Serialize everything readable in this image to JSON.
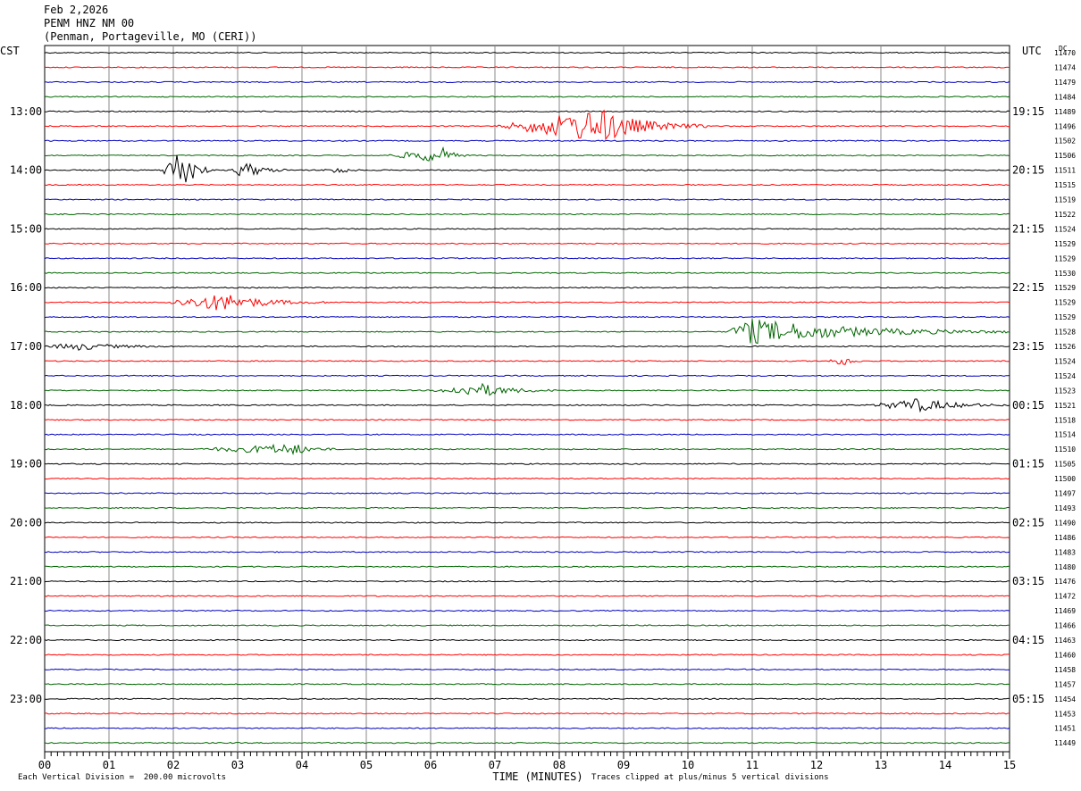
{
  "header": {
    "date": "Feb 2,2026",
    "station": "PENM HNZ NM 00",
    "location": "(Penman, Portageville, MO (CERI))"
  },
  "axis_labels": {
    "left_zone": "CST",
    "right_zone": "UTC",
    "dc": "DC",
    "x_title": "TIME (MINUTES)"
  },
  "footer": {
    "scale": "Each Vertical Division =  200.00 microvolts",
    "clip": "Traces clipped at plus/minus 5 vertical divisions"
  },
  "chart_data": {
    "type": "line",
    "title": "PENM HNZ NM 00",
    "xlabel": "TIME (MINUTES)",
    "xlim": [
      0,
      15
    ],
    "x_ticks": [
      "00",
      "01",
      "02",
      "03",
      "04",
      "05",
      "06",
      "07",
      "08",
      "09",
      "10",
      "11",
      "12",
      "13",
      "14",
      "15"
    ],
    "trace_colors": [
      "#000000",
      "#ff0000",
      "#0000c0",
      "#006600"
    ],
    "left_time_labels": [
      {
        "row": 4,
        "label": "13:00"
      },
      {
        "row": 8,
        "label": "14:00"
      },
      {
        "row": 12,
        "label": "15:00"
      },
      {
        "row": 16,
        "label": "16:00"
      },
      {
        "row": 20,
        "label": "17:00"
      },
      {
        "row": 24,
        "label": "18:00"
      },
      {
        "row": 28,
        "label": "19:00"
      },
      {
        "row": 32,
        "label": "20:00"
      },
      {
        "row": 36,
        "label": "21:00"
      },
      {
        "row": 40,
        "label": "22:00"
      },
      {
        "row": 44,
        "label": "23:00"
      }
    ],
    "right_time_labels": [
      {
        "row": 4,
        "label": "19:15"
      },
      {
        "row": 8,
        "label": "20:15"
      },
      {
        "row": 12,
        "label": "21:15"
      },
      {
        "row": 16,
        "label": "22:15"
      },
      {
        "row": 20,
        "label": "23:15"
      },
      {
        "row": 24,
        "label": "00:15"
      },
      {
        "row": 28,
        "label": "01:15"
      },
      {
        "row": 32,
        "label": "02:15"
      },
      {
        "row": 36,
        "label": "03:15"
      },
      {
        "row": 40,
        "label": "04:15"
      },
      {
        "row": 44,
        "label": "05:15"
      }
    ],
    "dc_offsets": [
      "11470",
      "11474",
      "11479",
      "11484",
      "11489",
      "11496",
      "11502",
      "11506",
      "11511",
      "11515",
      "11519",
      "11522",
      "11524",
      "11529",
      "11529",
      "11530",
      "11529",
      "11529",
      "11529",
      "11528",
      "11526",
      "11524",
      "11524",
      "11523",
      "11521",
      "11518",
      "11514",
      "11510",
      "11505",
      "11500",
      "11497",
      "11493",
      "11490",
      "11486",
      "11483",
      "11480",
      "11476",
      "11472",
      "11469",
      "11466",
      "11463",
      "11460",
      "11458",
      "11457",
      "11454",
      "11453",
      "11451",
      "11449"
    ],
    "events": [
      {
        "row": 5,
        "start_min": 7.0,
        "peak_min": 8.65,
        "end_min": 10.3,
        "amp": 1.2
      },
      {
        "row": 7,
        "start_min": 5.3,
        "peak_min": 6.2,
        "end_min": 6.6,
        "amp": 0.5
      },
      {
        "row": 8,
        "start_min": 1.8,
        "peak_min": 2.15,
        "end_min": 2.6,
        "amp": 1.7
      },
      {
        "row": 8,
        "start_min": 2.9,
        "peak_min": 3.1,
        "end_min": 3.8,
        "amp": 0.6
      },
      {
        "row": 8,
        "start_min": 4.3,
        "peak_min": 4.6,
        "end_min": 4.9,
        "amp": 0.25
      },
      {
        "row": 17,
        "start_min": 1.8,
        "peak_min": 2.8,
        "end_min": 4.4,
        "amp": 0.6
      },
      {
        "row": 19,
        "start_min": 10.6,
        "peak_min": 10.95,
        "end_min": 15.0,
        "amp": 0.9
      },
      {
        "row": 20,
        "start_min": 0.0,
        "peak_min": 0.5,
        "end_min": 2.0,
        "amp": 0.25
      },
      {
        "row": 21,
        "start_min": 12.1,
        "peak_min": 12.5,
        "end_min": 12.7,
        "amp": 0.3
      },
      {
        "row": 23,
        "start_min": 6.0,
        "peak_min": 6.8,
        "end_min": 8.0,
        "amp": 0.45
      },
      {
        "row": 24,
        "start_min": 12.8,
        "peak_min": 13.6,
        "end_min": 15.0,
        "amp": 0.45
      },
      {
        "row": 27,
        "start_min": 2.3,
        "peak_min": 3.9,
        "end_min": 4.6,
        "amp": 0.35
      }
    ]
  }
}
